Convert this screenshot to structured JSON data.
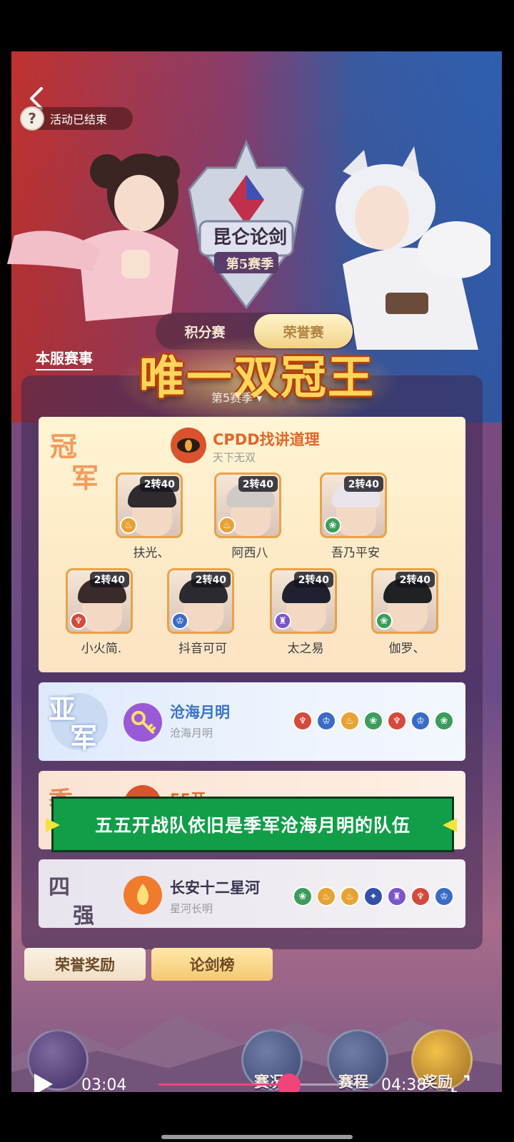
{
  "header": {
    "status_text": "活动已结束",
    "help_glyph": "?"
  },
  "event": {
    "title": "昆仑论剑",
    "season": "第5赛季",
    "tabs": [
      {
        "label": "积分赛",
        "active": false
      },
      {
        "label": "荣誉赛",
        "active": true
      }
    ],
    "server_link": "本服赛事",
    "banner_title": "唯一双冠王",
    "season_select": "第5赛季 ▾"
  },
  "results": {
    "champion": {
      "rank_chars": [
        "冠",
        "军"
      ],
      "team_name": "CPDD找讲道理",
      "team_sub": "天下无双",
      "heroes": [
        {
          "name": "扶光、",
          "level": "2转40",
          "faction": "gold",
          "hair": "#2f2a2f"
        },
        {
          "name": "阿西八",
          "level": "2转40",
          "faction": "gold",
          "hair": "#cfcac6"
        },
        {
          "name": "吾乃平安",
          "level": "2转40",
          "faction": "green",
          "hair": "#e9e5ea"
        },
        {
          "name": "小火简.",
          "level": "2转40",
          "faction": "red",
          "hair": "#3a2b2a"
        },
        {
          "name": "抖音可可",
          "level": "2转40",
          "faction": "blue",
          "hair": "#2b2a30"
        },
        {
          "name": "太之易",
          "level": "2转40",
          "faction": "purple",
          "hair": "#1f2030"
        },
        {
          "name": "伽罗、",
          "level": "2转40",
          "faction": "green",
          "hair": "#1e2224"
        }
      ]
    },
    "second": {
      "rank_chars": [
        "亚",
        "军"
      ],
      "team_name": "沧海月明",
      "team_sub": "沧海月明",
      "factions": [
        "red",
        "blue",
        "gold",
        "green",
        "red",
        "blue",
        "green"
      ]
    },
    "third": {
      "rank_chars": [
        "季"
      ],
      "team_name": "55开"
    },
    "fourth": {
      "rank_chars": [
        "四",
        "强"
      ],
      "team_name": "长安十二星河",
      "team_sub": "星河长明",
      "factions": [
        "green",
        "gold",
        "gold",
        "navy",
        "purple",
        "red",
        "blue"
      ]
    }
  },
  "subtitle": "五五开战队依旧是季军沧海月明的队伍",
  "buttons": {
    "honor_rewards": "荣誉奖励",
    "sword_ranking": "论剑榜"
  },
  "bottom_nav": [
    {
      "label": "赛况"
    },
    {
      "label": "赛程"
    },
    {
      "label": "奖励"
    }
  ],
  "video": {
    "current_time": "03:04",
    "total_time": "04:38",
    "progress": 0.61
  },
  "colors": {
    "accent_pink": "#f0457a",
    "subtitle_green": "#129e49",
    "gold_title": "#ffd65a"
  }
}
